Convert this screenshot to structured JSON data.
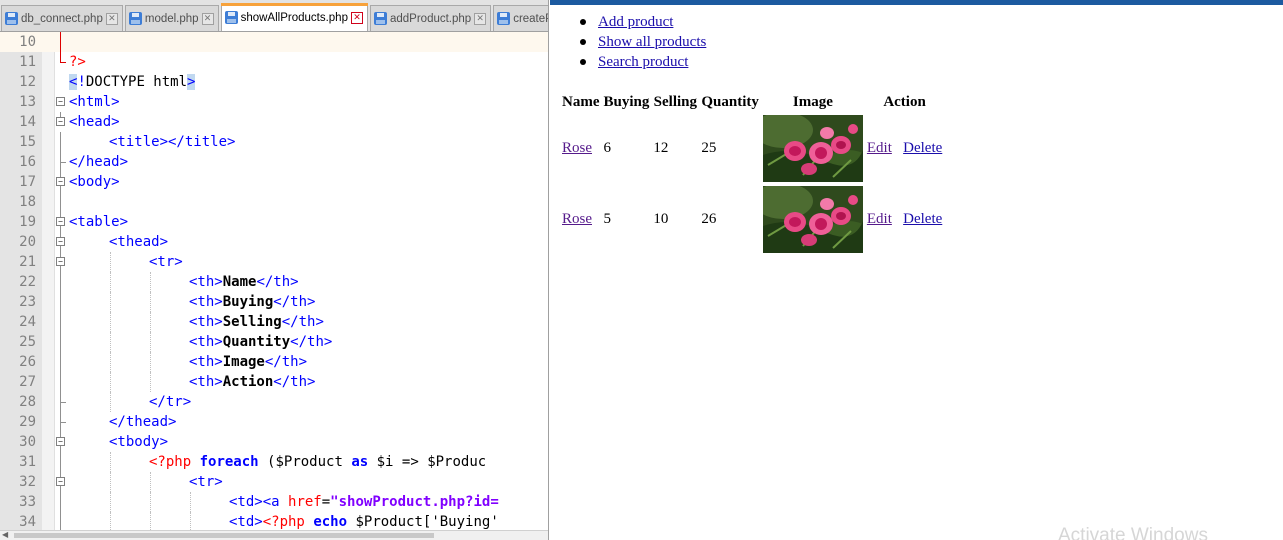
{
  "editor": {
    "tabs": [
      {
        "label": "db_connect.php",
        "active": false
      },
      {
        "label": "model.php",
        "active": false
      },
      {
        "label": "showAllProducts.php",
        "active": true
      },
      {
        "label": "addProduct.php",
        "active": false
      },
      {
        "label": "createProduct",
        "active": false
      }
    ],
    "line_numbers": [
      "10",
      "11",
      "12",
      "13",
      "14",
      "15",
      "16",
      "17",
      "18",
      "19",
      "20",
      "21",
      "22",
      "23",
      "24",
      "25",
      "26",
      "27",
      "28",
      "29",
      "30",
      "31",
      "32",
      "33",
      "34"
    ],
    "code": {
      "l11": "?>",
      "l12_a": "<",
      "l12_b": "!",
      "l12_c": "DOCTYPE html",
      "l12_d": ">",
      "l13": "<html>",
      "l14": "<head>",
      "l15": "<title></title>",
      "l16": "</head>",
      "l17": "<body>",
      "l19": "<table>",
      "l20": "<thead>",
      "l21": "<tr>",
      "th_open": "<th>",
      "th_close": "</th>",
      "th_name": "Name",
      "th_buying": "Buying",
      "th_selling": "Selling",
      "th_quantity": "Quantity",
      "th_image": "Image",
      "th_action": "Action",
      "l28": "</tr>",
      "l29": "</thead>",
      "l30": "<tbody>",
      "l31_php": "<?php",
      "l31_foreach": "foreach",
      "l31_paren": " ($Product ",
      "l31_as": "as",
      "l31_rest": " $i => $Produc",
      "l32": "<tr>",
      "l33_td": "<td><a ",
      "l33_attr": "href",
      "l33_eq": "=",
      "l33_str": "\"showProduct.php?id=",
      "l34_td": "<td>",
      "l34_php": "<?php",
      "l34_echo": "echo",
      "l34_rest": " $Product['Buying'"
    }
  },
  "browser": {
    "nav": [
      {
        "label": "Add product"
      },
      {
        "label": "Show all products"
      },
      {
        "label": "Search product"
      }
    ],
    "table": {
      "headers": [
        "Name",
        "Buying",
        "Selling",
        "Quantity",
        "Image",
        "Action"
      ],
      "rows": [
        {
          "name": "Rose",
          "buying": "6",
          "selling": "12",
          "quantity": "25",
          "edit": "Edit",
          "delete": "Delete"
        },
        {
          "name": "Rose",
          "buying": "5",
          "selling": "10",
          "quantity": "26",
          "edit": "Edit",
          "delete": "Delete"
        }
      ]
    },
    "watermark": "Activate Windows"
  },
  "colors": {
    "tab_accent": "#f7a23b",
    "browser_topbar": "#1c5aa0",
    "link": "#1a0dab",
    "link_visited": "#551a8b",
    "html_tag": "#0000ff",
    "php_tag": "#ff0000"
  }
}
